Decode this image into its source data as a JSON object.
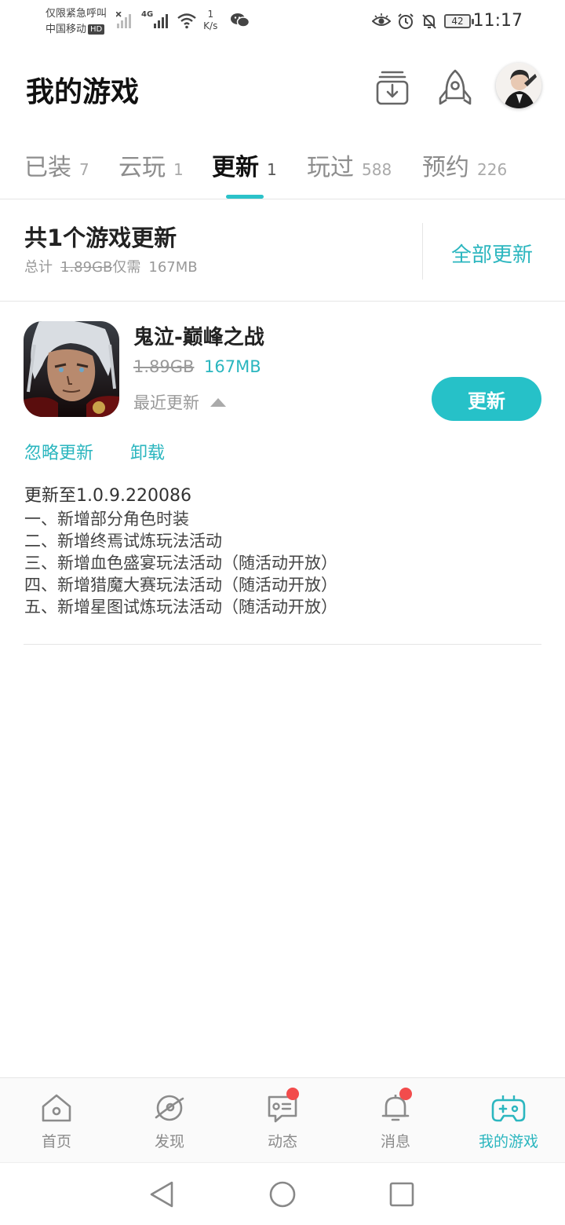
{
  "status_bar": {
    "carrier_line1": "仅限紧急呼叫",
    "carrier_line2": "中国移动",
    "hd_badge": "HD",
    "network": "4G",
    "speed_value": "1",
    "speed_unit": "K/s",
    "battery": "42",
    "time": "11:17"
  },
  "header": {
    "title": "我的游戏",
    "download_icon": "download-tray-icon",
    "rocket_icon": "rocket-icon",
    "avatar": "user-avatar"
  },
  "tabs": [
    {
      "label": "已装",
      "count": "7"
    },
    {
      "label": "云玩",
      "count": "1"
    },
    {
      "label": "更新",
      "count": "1",
      "active": true
    },
    {
      "label": "玩过",
      "count": "588"
    },
    {
      "label": "预约",
      "count": "226"
    }
  ],
  "summary": {
    "title": "共1个游戏更新",
    "total_label": "总计",
    "original_size": "1.89GB",
    "need_label": "仅需",
    "download_size": "167MB",
    "update_all": "全部更新"
  },
  "game": {
    "name": "鬼泣-巅峰之战",
    "old_size": "1.89GB",
    "new_size": "167MB",
    "recent_label": "最近更新",
    "update_button": "更新",
    "ignore_link": "忽略更新",
    "uninstall_link": "卸载",
    "version_line": "更新至1.0.9.220086",
    "notes": [
      "一、新增部分角色时装",
      "二、新增终焉试炼玩法活动",
      "三、新增血色盛宴玩法活动（随活动开放）",
      "四、新增猎魔大赛玩法活动（随活动开放）",
      "五、新增星图试炼玩法活动（随活动开放）"
    ]
  },
  "bottom_nav": [
    {
      "label": "首页",
      "icon": "home-icon"
    },
    {
      "label": "发现",
      "icon": "discover-icon"
    },
    {
      "label": "动态",
      "icon": "feed-icon",
      "badge": true
    },
    {
      "label": "消息",
      "icon": "bell-icon",
      "badge": true
    },
    {
      "label": "我的游戏",
      "icon": "gamepad-icon",
      "active": true
    }
  ],
  "colors": {
    "accent": "#26C1C8",
    "badge": "#F24C4C"
  }
}
